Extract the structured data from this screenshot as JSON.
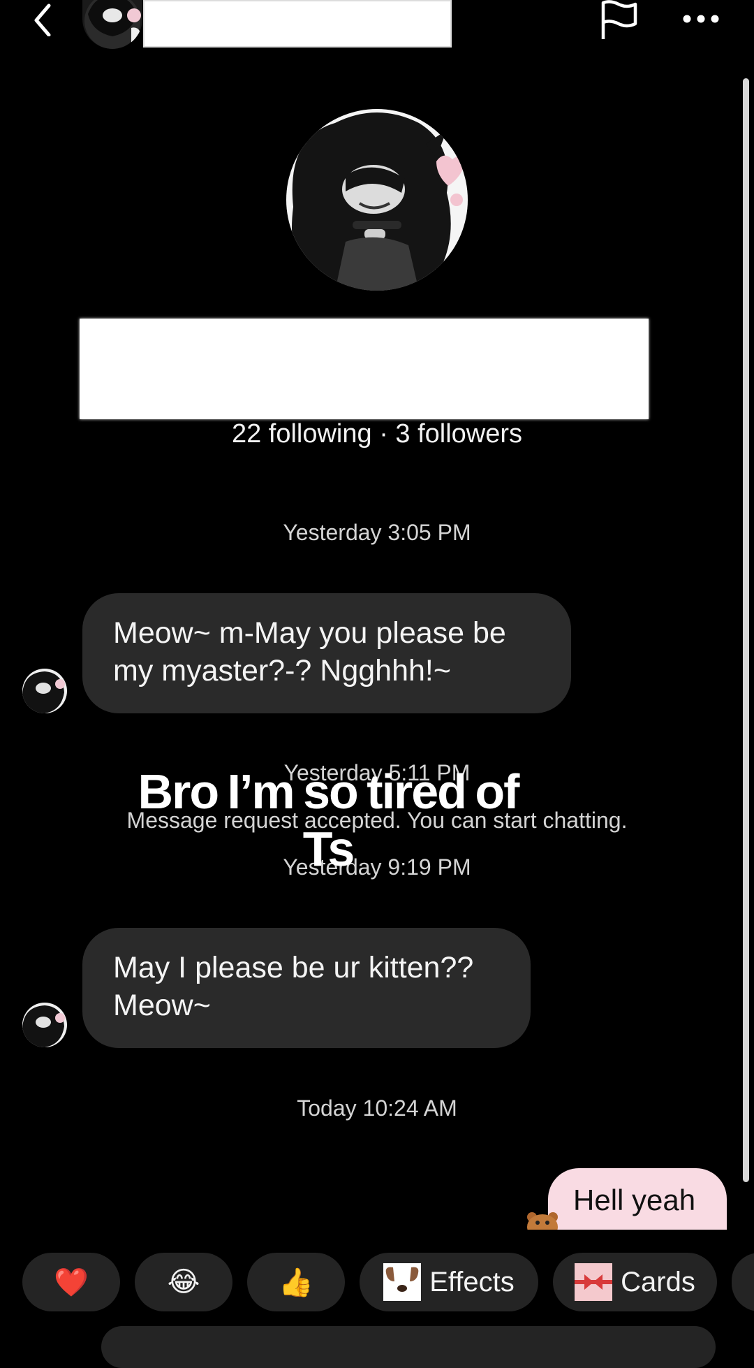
{
  "header": {
    "back_icon": "chevron-left-icon",
    "flag_icon": "flag-icon",
    "more_icon": "more-horizontal-icon"
  },
  "profile": {
    "stats": "22 following · 3 followers"
  },
  "messages": [
    {
      "type": "timestamp",
      "text": "Yesterday 3:05 PM"
    },
    {
      "type": "incoming",
      "text_line1": "Meow~ m-May you please be",
      "text_line2": "my myaster?-? Ngghhh!~"
    },
    {
      "type": "timestamp",
      "text": "Yesterday 5:11 PM"
    },
    {
      "type": "system",
      "text": "Message request accepted. You can start chatting."
    },
    {
      "type": "timestamp",
      "text": "Yesterday 9:19 PM"
    },
    {
      "type": "incoming",
      "text_line1": "May I please be ur kitten??",
      "text_line2": "Meow~"
    },
    {
      "type": "timestamp",
      "text": "Today 10:24 AM"
    },
    {
      "type": "outgoing",
      "text": "Hell yeah"
    }
  ],
  "overlay_caption": {
    "line1": "Bro I’m so tired of",
    "line2": "Ts"
  },
  "quick_actions": {
    "heart": "❤️",
    "laugh": "😂",
    "thumbs": "👍",
    "effects_label": "Effects",
    "cards_label": "Cards"
  },
  "colors": {
    "background": "#000000",
    "bubble_incoming": "#2a2a2a",
    "bubble_outgoing": "#f9dbe3",
    "chip_bg": "#242424"
  }
}
